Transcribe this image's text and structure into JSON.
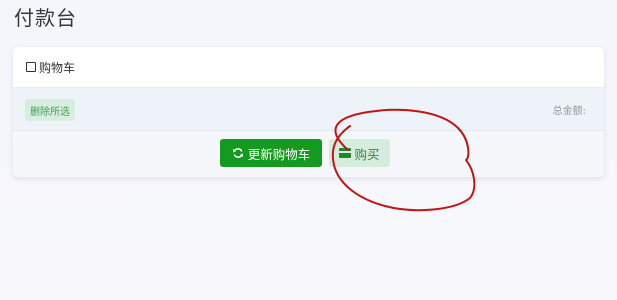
{
  "page": {
    "title": "付款台"
  },
  "cart": {
    "select_all_label": "购物车",
    "delete_selected_label": "删除所选",
    "total_label": "总金额:",
    "update_button_label": "更新购物车",
    "buy_button_label": "购买"
  },
  "icons": {
    "update": "refresh-icon",
    "buy": "credit-card-icon"
  },
  "colors": {
    "primary_green": "#149a1f",
    "light_green": "#d6ecdd",
    "annotation_red": "#c41414"
  }
}
